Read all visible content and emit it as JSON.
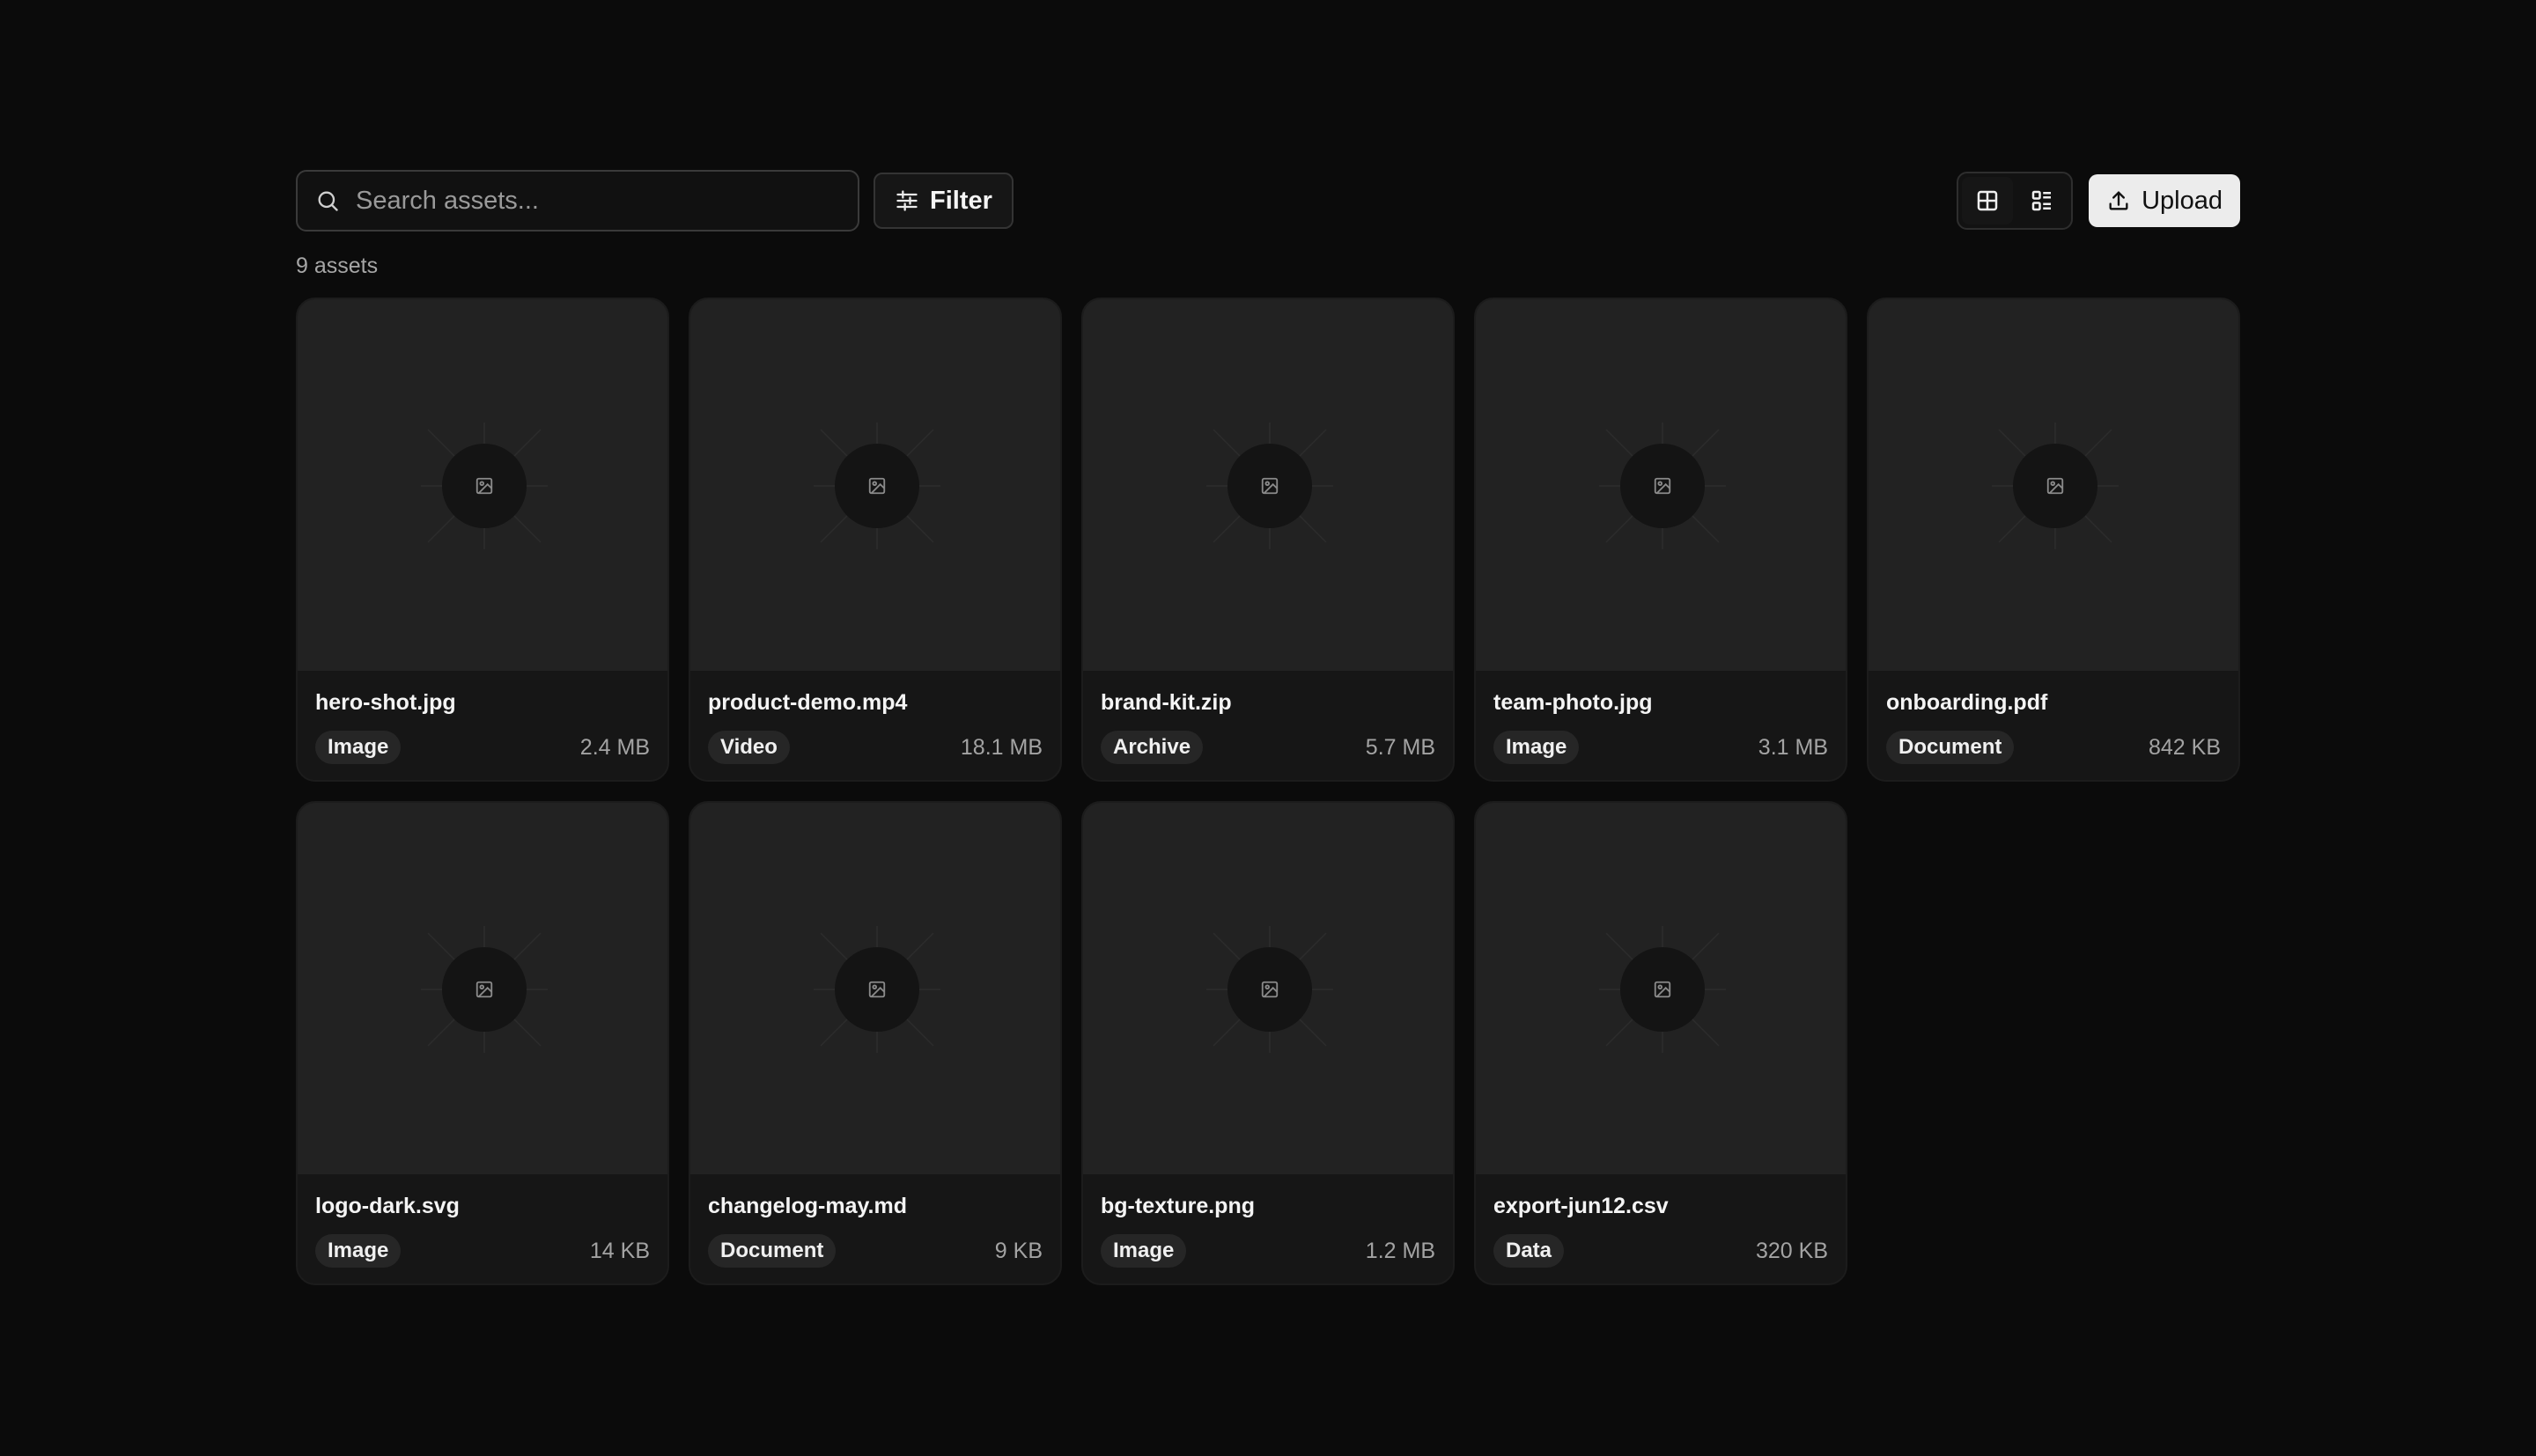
{
  "toolbar": {
    "search_placeholder": "Search assets...",
    "search_value": "",
    "filter_label": "Filter",
    "upload_label": "Upload",
    "view_modes": [
      "grid",
      "list"
    ],
    "active_view": "grid"
  },
  "count_label": "9 assets",
  "assets": [
    {
      "name": "hero-shot.jpg",
      "type": "Image",
      "size": "2.4 MB"
    },
    {
      "name": "product-demo.mp4",
      "type": "Video",
      "size": "18.1 MB"
    },
    {
      "name": "brand-kit.zip",
      "type": "Archive",
      "size": "5.7 MB"
    },
    {
      "name": "team-photo.jpg",
      "type": "Image",
      "size": "3.1 MB"
    },
    {
      "name": "onboarding.pdf",
      "type": "Document",
      "size": "842 KB"
    },
    {
      "name": "logo-dark.svg",
      "type": "Image",
      "size": "14 KB"
    },
    {
      "name": "changelog-may.md",
      "type": "Document",
      "size": "9 KB"
    },
    {
      "name": "bg-texture.png",
      "type": "Image",
      "size": "1.2 MB"
    },
    {
      "name": "export-jun12.csv",
      "type": "Data",
      "size": "320 KB"
    }
  ],
  "icons": {
    "search": "search-icon",
    "filter": "sliders-icon",
    "grid_view": "grid-icon",
    "list_view": "list-icon",
    "upload": "upload-icon",
    "thumbnail": "image-placeholder-icon"
  },
  "colors": {
    "background": "#0b0b0b",
    "card": "#161616",
    "thumbnail": "#222222",
    "accent_button": "#ececec"
  }
}
